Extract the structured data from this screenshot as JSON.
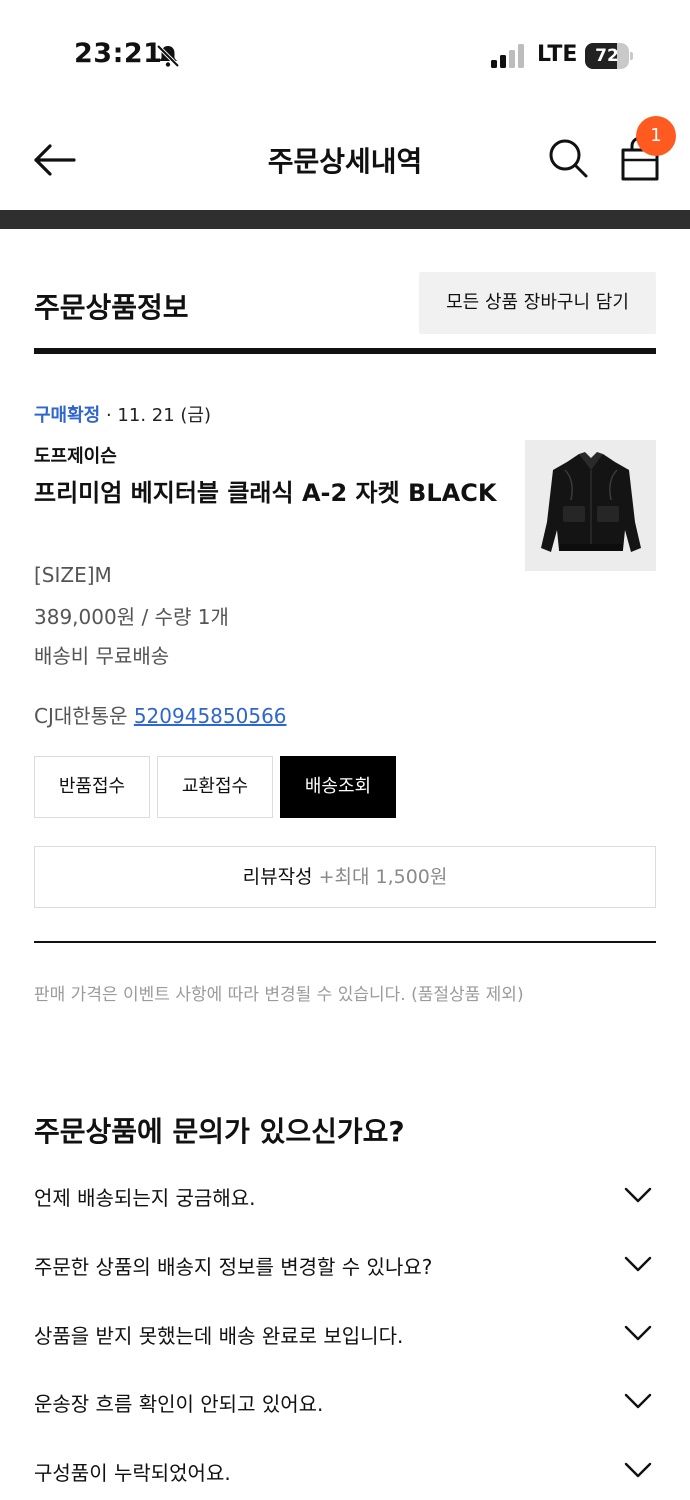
{
  "status_bar": {
    "time": "23:21",
    "network": "LTE",
    "battery": "72",
    "battery_level": 0.72
  },
  "header": {
    "title": "주문상세내역",
    "cart_count": "1"
  },
  "order_section": {
    "title": "주문상품정보",
    "add_all_button": "모든 상품 장바구니 담기",
    "status": "구매확정",
    "date": " · 11. 21 (금)",
    "brand": "도프제이슨",
    "product_name": "프리미엄 베지터블 클래식 A-2 자켓 BLACK",
    "option": "[SIZE]M",
    "price_qty": "389,000원 / 수량 1개",
    "shipping_fee": "배송비 무료배송",
    "carrier": "CJ대한통운 ",
    "tracking_number": "520945850566",
    "actions": {
      "return": "반품접수",
      "exchange": "교환접수",
      "tracking": "배송조회"
    },
    "review": {
      "label": "리뷰작성 ",
      "bonus": "+최대 1,500원"
    },
    "notice": "판매 가격은 이벤트 사항에 따라 변경될 수 있습니다. (품절상품 제외)"
  },
  "faq": {
    "title": "주문상품에 문의가 있으신가요?",
    "items": [
      "언제 배송되는지 궁금해요.",
      "주문한 상품의 배송지 정보를 변경할 수 있나요?",
      "상품을 받지 못했는데 배송 완료로 보입니다.",
      "운송장 흐름 확인이 안되고 있어요.",
      "구성품이 누락되었어요."
    ]
  },
  "icons": {
    "back": "arrow-left-icon",
    "search": "search-icon",
    "bag": "shopping-bag-icon",
    "expand": "chevron-down-icon",
    "bell_off": "bell-off-icon"
  },
  "colors": {
    "accent_blue": "#2f66d0",
    "badge_orange": "#ff5a1f",
    "divider_dark": "#2f2f2f"
  }
}
